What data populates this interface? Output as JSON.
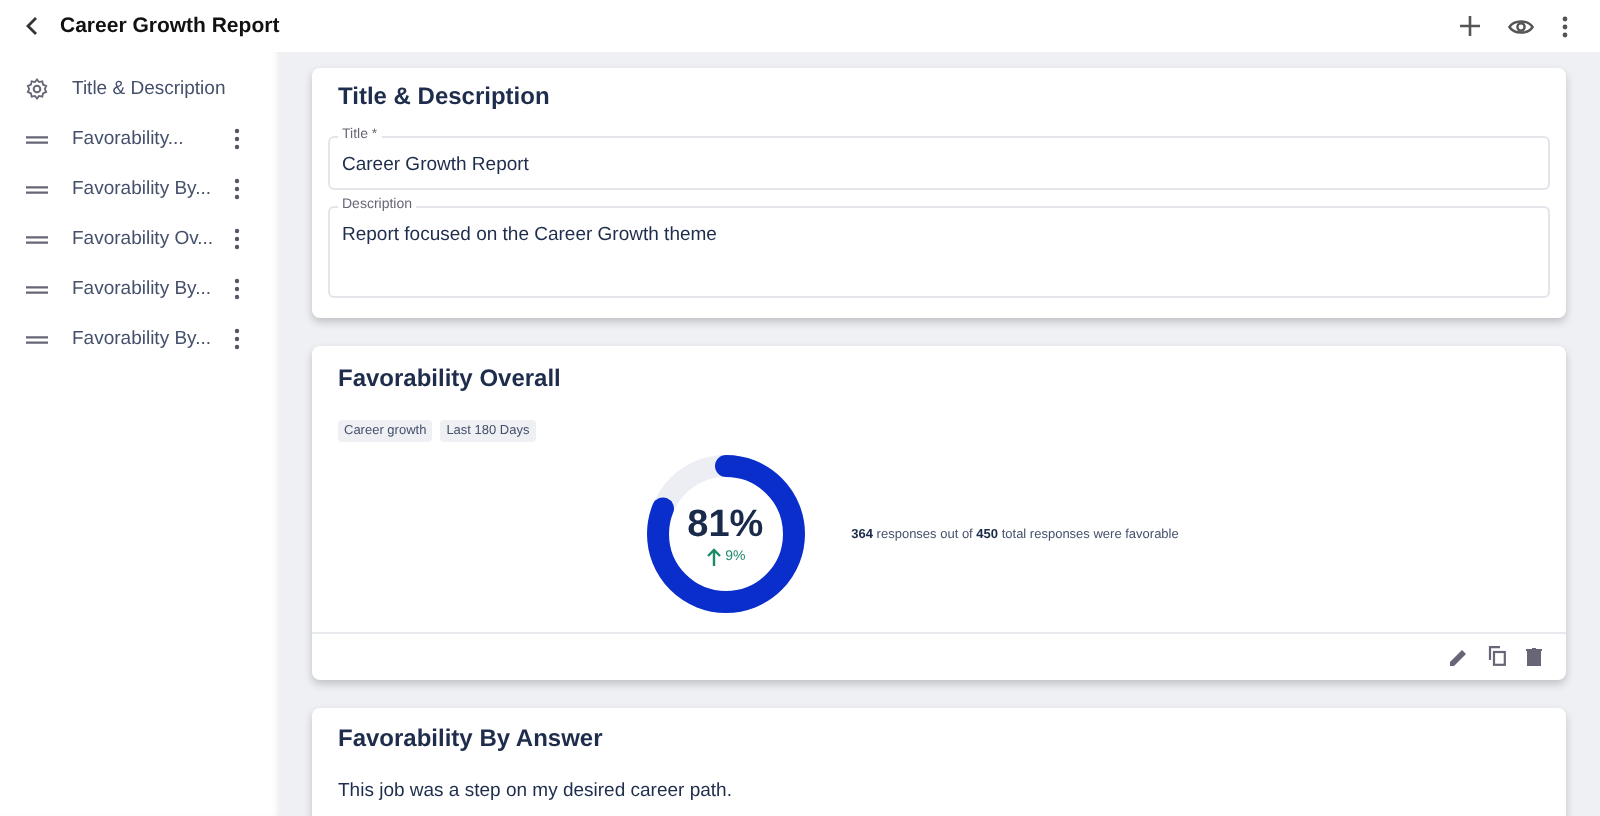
{
  "header": {
    "title": "Career Growth Report"
  },
  "sidebar": {
    "items": [
      {
        "kind": "settings",
        "label": "Title & Description"
      },
      {
        "kind": "section",
        "label": "Favorability..."
      },
      {
        "kind": "section",
        "label": "Favorability By..."
      },
      {
        "kind": "section",
        "label": "Favorability Ov..."
      },
      {
        "kind": "section",
        "label": "Favorability By..."
      },
      {
        "kind": "section",
        "label": "Favorability By..."
      }
    ]
  },
  "title_card": {
    "heading": "Title & Description",
    "fields": [
      {
        "label": "Title *",
        "value": "Career Growth Report"
      },
      {
        "label": "Description",
        "value": "Report focused on the Career Growth theme"
      }
    ]
  },
  "overall_card": {
    "heading": "Favorability Overall",
    "tags": [
      "Career growth",
      "Last 180 Days"
    ],
    "gauge": {
      "level": 0.81,
      "percent": "81%",
      "change": "9%"
    },
    "summary": "**364** responses out of **450** total responses were favorable"
  },
  "answer_card": {
    "heading": "Favorability By Answer",
    "question": "This job was a step on my desired career path."
  }
}
